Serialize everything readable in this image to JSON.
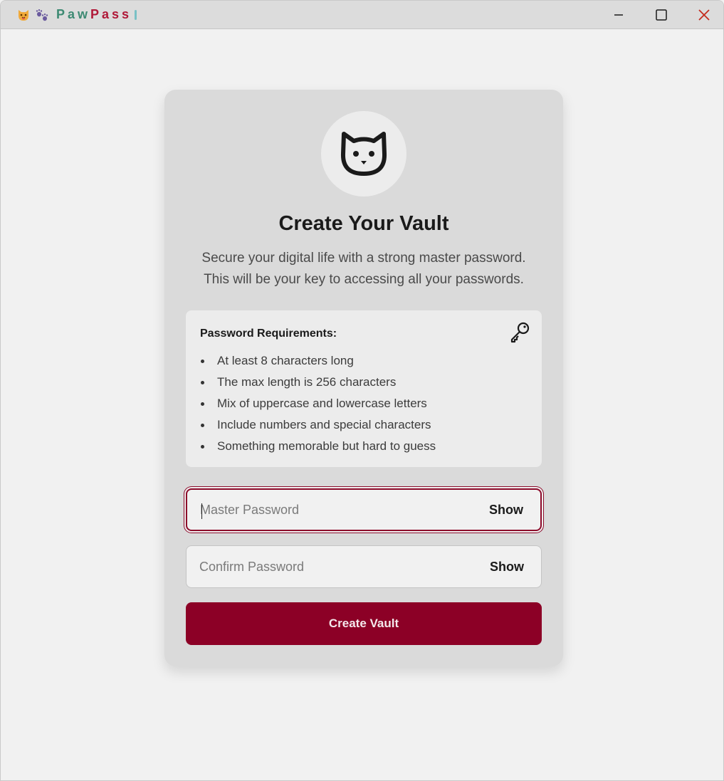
{
  "titlebar": {
    "brand_paw": "Paw",
    "brand_pass": "Pass",
    "icons": [
      "cat-face-icon",
      "paw-prints-icon"
    ],
    "controls": [
      "minimize-icon",
      "maximize-icon",
      "close-icon"
    ]
  },
  "vault": {
    "avatar_icon": "cat-face-icon",
    "title": "Create Your Vault",
    "subtitle_line1": "Secure your digital life with a strong master password.",
    "subtitle_line2": "This will be your key to accessing all your passwords."
  },
  "requirements": {
    "title": "Password Requirements:",
    "icon": "key-icon",
    "items": [
      "At least 8 characters long",
      "The max length is 256 characters",
      "Mix of uppercase and lowercase letters",
      "Include numbers and special characters",
      "Something memorable but hard to guess"
    ]
  },
  "form": {
    "master_password": {
      "value": "",
      "placeholder": "Master Password",
      "show_label": "Show"
    },
    "confirm_password": {
      "value": "",
      "placeholder": "Confirm Password",
      "show_label": "Show"
    },
    "submit_label": "Create Vault"
  },
  "colors": {
    "accent": "#8c0026",
    "brand_green": "#3d8a73",
    "brand_red": "#b01838",
    "close_red": "#c42b1c"
  }
}
